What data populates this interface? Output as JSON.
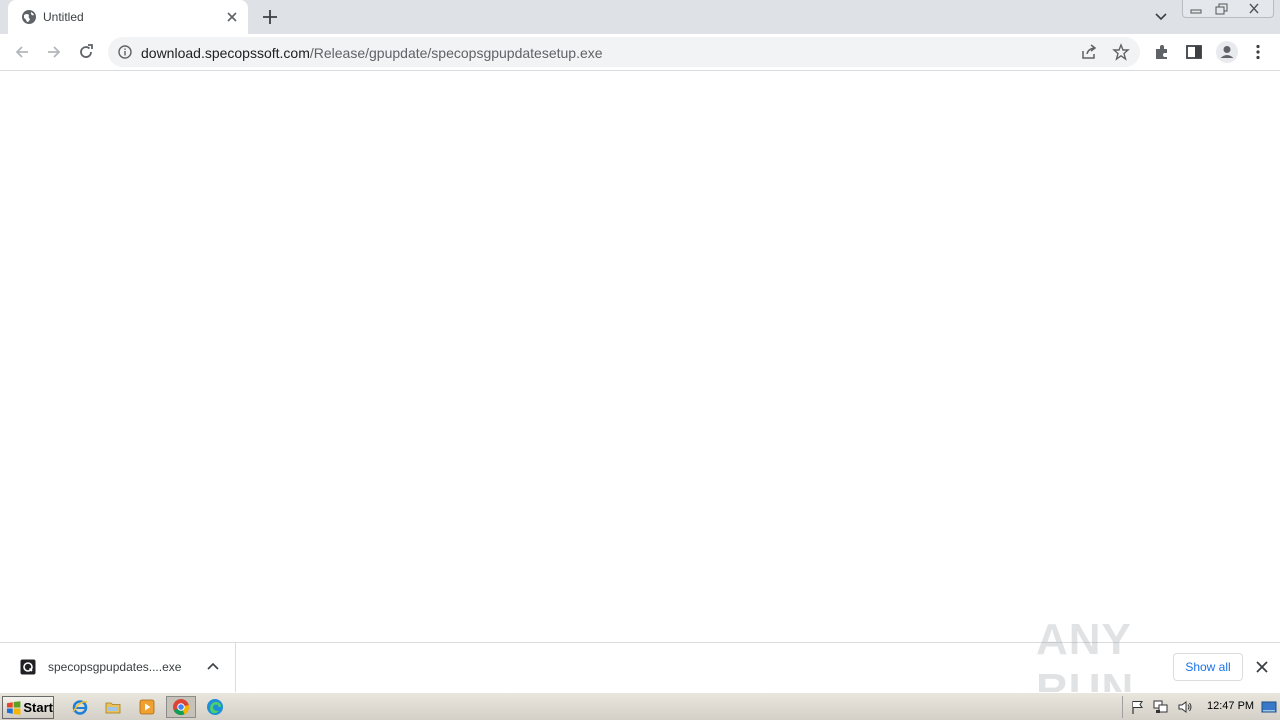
{
  "browser": {
    "tab": {
      "title": "Untitled"
    },
    "address": {
      "host": "download.specopssoft.com",
      "path": "/Release/gpupdate/specopsgpupdatesetup.exe"
    }
  },
  "download_bar": {
    "file_name": "specopsgpupdates....exe",
    "show_all_label": "Show all",
    "watermark_text": "ANY RUN"
  },
  "taskbar": {
    "start_label": "Start",
    "clock": "12:47 PM",
    "apps": [
      "internet-explorer-icon",
      "file-explorer-icon",
      "media-player-icon",
      "chrome-icon",
      "edge-icon"
    ]
  },
  "colors": {
    "tabstrip_bg": "#dee1e6",
    "omnibox_bg": "#f1f3f4",
    "link_blue": "#1a73e8",
    "taskbar_bg": "#d4d0c8"
  }
}
